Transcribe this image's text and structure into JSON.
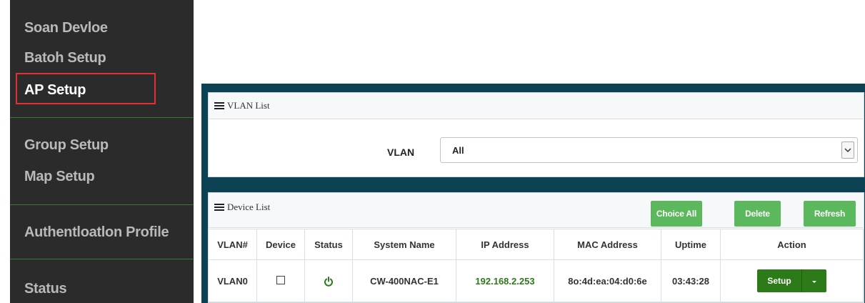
{
  "sidebar": {
    "items": [
      {
        "label": "Soan Devloe",
        "active": false
      },
      {
        "label": "Batoh Setup",
        "active": false
      },
      {
        "label": "AP Setup",
        "active": true
      },
      {
        "label": "Group Setup",
        "active": false
      },
      {
        "label": "Map Setup",
        "active": false
      },
      {
        "label": "Authentloatlon Profile",
        "active": false
      },
      {
        "label": "Status",
        "active": false
      }
    ],
    "highlight_color": "#e32f2f",
    "divider_color": "#2f7d34"
  },
  "vlan_panel": {
    "title": "VLAN List",
    "field_label": "VLAN",
    "selected_value": "All"
  },
  "device_panel": {
    "title": "Device List",
    "buttons": {
      "choice_all": "Choice All",
      "delete": "Delete",
      "refresh": "Refresh"
    },
    "columns": [
      "VLAN#",
      "Device",
      "Status",
      "System Name",
      "IP Address",
      "MAC Address",
      "Uptime",
      "Action"
    ],
    "rows": [
      {
        "vlan": "VLAN0",
        "device_checked": false,
        "status_icon": "power-icon",
        "system_name": "CW-400NAC-E1",
        "ip_address": "192.168.2.253",
        "mac_address": "8o:4d:ea:04:d0:6e",
        "uptime": "03:43:28",
        "action_label": "Setup"
      }
    ]
  },
  "colors": {
    "panel_background": "#0d4255",
    "button_green": "#5cb85c",
    "setup_green": "#2d7a18",
    "ip_green": "#2c7a1b"
  }
}
